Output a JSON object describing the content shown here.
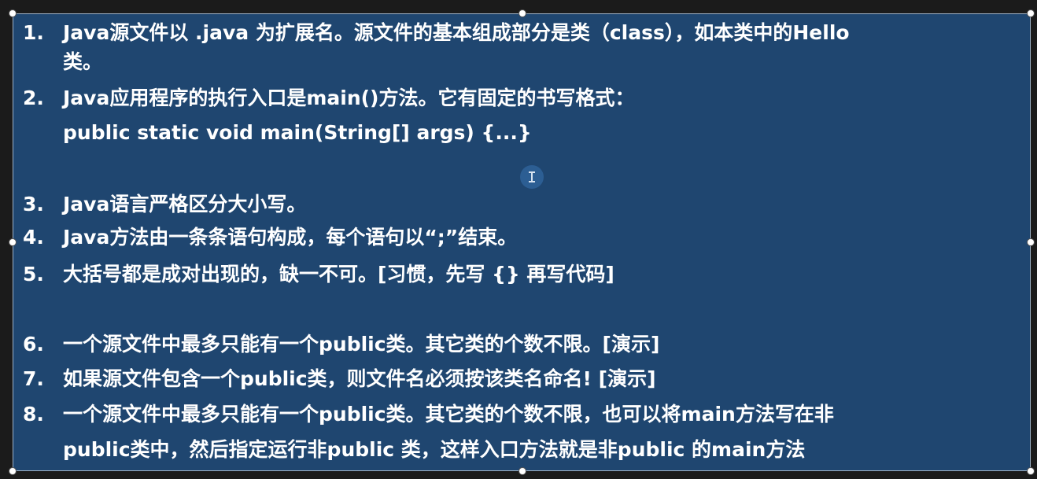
{
  "colors": {
    "background": "#1b1b1b",
    "box_fill": "#1f4670",
    "text": "#ffffff"
  },
  "items": [
    {
      "num": "1.",
      "lines": [
        "Java源文件以 .java 为扩展名。源文件的基本组成部分是类（class），如本类中的Hello",
        "类。"
      ]
    },
    {
      "num": "2.",
      "lines": [
        "Java应用程序的执行入口是main()方法。它有固定的书写格式：",
        "public static void main(String[] args) {...}"
      ]
    },
    {
      "num": "3.",
      "lines": [
        "Java语言严格区分大小写。"
      ]
    },
    {
      "num": "4.",
      "lines": [
        "Java方法由一条条语句构成，每个语句以“;”结束。"
      ]
    },
    {
      "num": "5.",
      "lines": [
        "大括号都是成对出现的，缺一不可。[习惯，先写 {} 再写代码]"
      ]
    },
    {
      "num": "6.",
      "lines": [
        "一个源文件中最多只能有一个public类。其它类的个数不限。[演示]"
      ]
    },
    {
      "num": "7.",
      "lines": [
        "如果源文件包含一个public类，则文件名必须按该类名命名! [演示]"
      ]
    },
    {
      "num": "8.",
      "lines": [
        "一个源文件中最多只能有一个public类。其它类的个数不限，也可以将main方法写在非",
        "public类中，然后指定运行非public 类，这样入口方法就是非public 的main方法"
      ]
    }
  ]
}
